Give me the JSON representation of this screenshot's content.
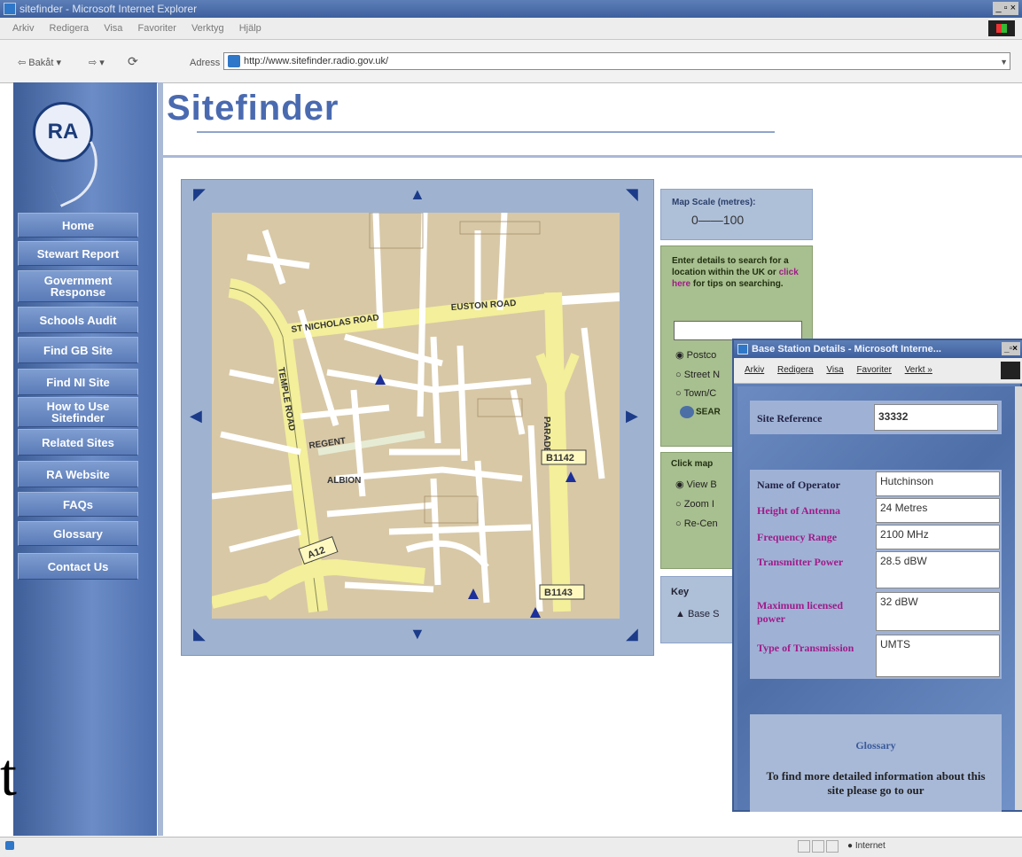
{
  "browser": {
    "title": "sitefinder - Microsoft Internet Explorer",
    "menu": [
      "Arkiv",
      "Redigera",
      "Visa",
      "Favoriter",
      "Verktyg",
      "Hjälp"
    ],
    "back_label": "Bakåt",
    "address_label": "Adress",
    "url": "http://www.sitefinder.radio.gov.uk/",
    "status_zone": "Internet"
  },
  "site": {
    "logo_text": "RA",
    "title": "Sitefinder",
    "nav": [
      "Home",
      "Stewart Report",
      "Government Response",
      "Schools Audit",
      "Find GB Site",
      "Find NI Site",
      "How to Use Sitefinder",
      "Related Sites",
      "RA Website",
      "FAQs",
      "Glossary",
      "Contact Us"
    ]
  },
  "map": {
    "road_labels": [
      "ST NICHOLAS ROAD",
      "EUSTON ROAD",
      "TEMPLE ROAD",
      "A12",
      "B1142",
      "B1143",
      "PARADE",
      "REGENT",
      "ALBION"
    ],
    "scale_label": "Map Scale (metres):",
    "scale_text": "0——100"
  },
  "search": {
    "prompt_before": "Enter details to search for a location within the UK or ",
    "link_text": "click here",
    "prompt_after": " for tips on searching.",
    "options": [
      "Postco",
      "Street N",
      "Town/C"
    ],
    "button_label": "SEAR"
  },
  "click_map": {
    "label": "Click map",
    "options": [
      "View B",
      "Zoom I",
      "Re-Cen"
    ]
  },
  "key": {
    "label": "Key",
    "item": "▲ Base S"
  },
  "popup": {
    "title": "Base Station Details - Microsoft Interne...",
    "menu": [
      "Arkiv",
      "Redigera",
      "Visa",
      "Favoriter",
      "Verkt »"
    ],
    "site_reference_label": "Site Reference",
    "site_reference": "33332",
    "rows": [
      {
        "label": "Name of Operator",
        "value": "Hutchinson"
      },
      {
        "label": "Height of Antenna",
        "value": "24 Metres"
      },
      {
        "label": "Frequency Range",
        "value": "2100 MHz"
      },
      {
        "label": "Transmitter Power",
        "value": "28.5 dBW"
      },
      {
        "label": "Maximum licensed power",
        "value": "32 dBW"
      },
      {
        "label": "Type of Transmission",
        "value": "UMTS"
      }
    ],
    "glossary_link": "Glossary",
    "glossary_text": "To find more detailed information about this site please go to our"
  },
  "stray_text": "t"
}
